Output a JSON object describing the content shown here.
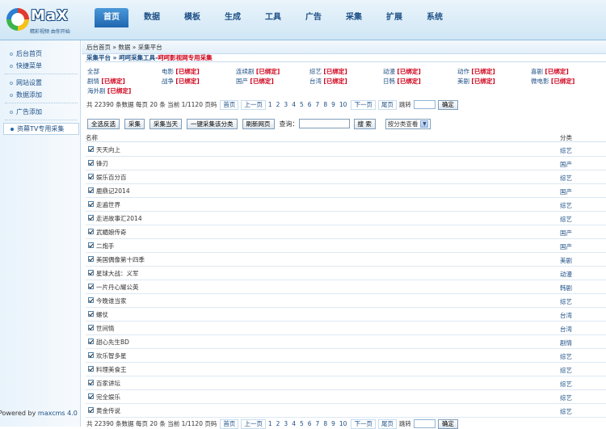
{
  "logo": {
    "word": "MaX",
    "slogan": "精彩视频 由你开始"
  },
  "nav": [
    "首页",
    "数据",
    "模板",
    "生成",
    "工具",
    "广告",
    "采集",
    "扩展",
    "系统"
  ],
  "sidebar": {
    "items": [
      "后台首页",
      "快捷菜单",
      "网站设置",
      "数据添加",
      "广告添加",
      "资幕TV专用采集"
    ],
    "powered_prefix": "Powered by ",
    "powered_link": "maxcms 4.0"
  },
  "breadcrumb": "后台首页 » 数据 » 采集平台",
  "title": {
    "prefix": "采集平台 » 呵呵采集工具-",
    "red": "呵呵影视网专用采集"
  },
  "bind_label": "[已绑定]",
  "categories": [
    {
      "name": "全部",
      "bound": false
    },
    {
      "name": "电影",
      "bound": true
    },
    {
      "name": "连续剧",
      "bound": true
    },
    {
      "name": "综艺",
      "bound": true
    },
    {
      "name": "动漫",
      "bound": true
    },
    {
      "name": "动作",
      "bound": true
    },
    {
      "name": "喜剧",
      "bound": true
    },
    {
      "name": "剧情",
      "bound": true
    },
    {
      "name": "战争",
      "bound": true
    },
    {
      "name": "国产",
      "bound": true
    },
    {
      "name": "台湾",
      "bound": true
    },
    {
      "name": "日韩",
      "bound": true
    },
    {
      "name": "美剧",
      "bound": true
    },
    {
      "name": "微电影",
      "bound": true
    },
    {
      "name": "海外剧",
      "bound": true
    }
  ],
  "pager": {
    "summary": "共 22390 条数据 每页 20 条 当前 1/1120 页码",
    "first": "首页",
    "prev": "上一页",
    "pages": [
      "1",
      "2",
      "3",
      "4",
      "5",
      "6",
      "7",
      "8",
      "9",
      "10"
    ],
    "next": "下一页",
    "last": "尾页",
    "jump_label": "跳转",
    "confirm": "确定"
  },
  "toolbar": {
    "buttons": [
      "全选反选",
      "采集",
      "采集当天",
      "一键采集该分类",
      "刷新网页"
    ],
    "query_label": "查询：",
    "search": "搜 索",
    "select_value": "按分类查看"
  },
  "table": {
    "col_name": "名称",
    "col_cat": "分类",
    "rows": [
      {
        "name": "天天向上",
        "cat": "综艺"
      },
      {
        "name": "锋刃",
        "cat": "国产"
      },
      {
        "name": "娱乐百分百",
        "cat": "综艺"
      },
      {
        "name": "鹿鼎记2014",
        "cat": "国产"
      },
      {
        "name": "走遍世界",
        "cat": "综艺"
      },
      {
        "name": "走进故事汇2014",
        "cat": "综艺"
      },
      {
        "name": "武媚娘传奇",
        "cat": "国产"
      },
      {
        "name": "二炮手",
        "cat": "国产"
      },
      {
        "name": "美国偶像第十四季",
        "cat": "美剧"
      },
      {
        "name": "星球大战：义军",
        "cat": "动漫"
      },
      {
        "name": "一片丹心耀公英",
        "cat": "韩剧"
      },
      {
        "name": "今晚谁当家",
        "cat": "综艺"
      },
      {
        "name": "螺仗",
        "cat": "台湾"
      },
      {
        "name": "世间情",
        "cat": "台湾"
      },
      {
        "name": "甜心先生BD",
        "cat": "剧情"
      },
      {
        "name": "欢乐智多星",
        "cat": "综艺"
      },
      {
        "name": "料理美食王",
        "cat": "综艺"
      },
      {
        "name": "百家讲坛",
        "cat": "综艺"
      },
      {
        "name": "完全娱乐",
        "cat": "综艺"
      },
      {
        "name": "黄金传说",
        "cat": "综艺"
      }
    ]
  }
}
